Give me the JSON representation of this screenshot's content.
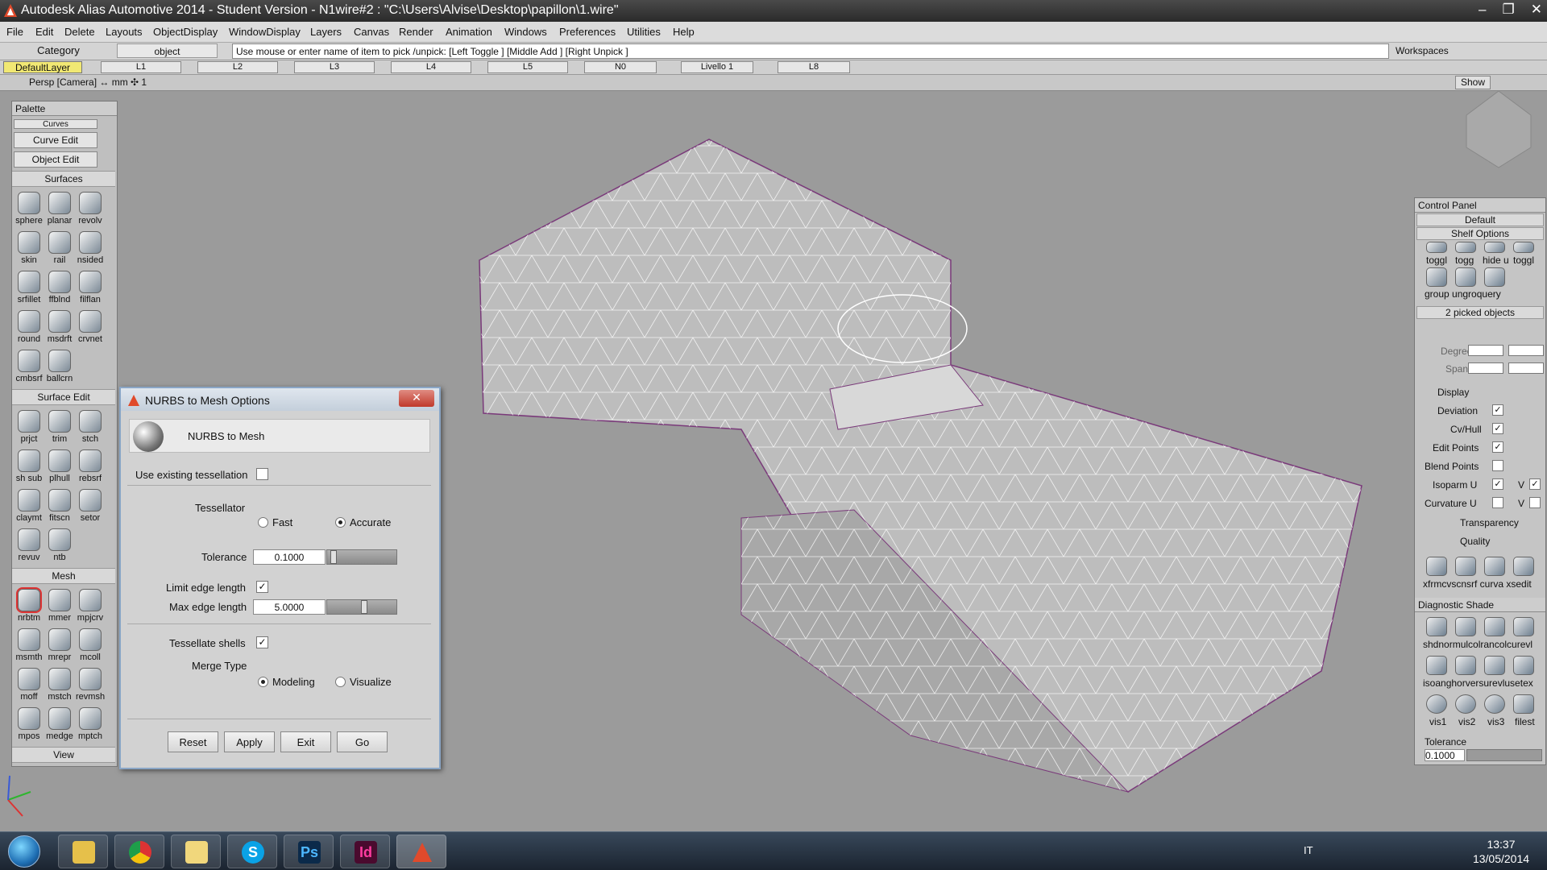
{
  "window": {
    "title": "Autodesk Alias Automotive 2014   - Student Version   - N1wire#2 : \"C:\\Users\\Alvise\\Desktop\\papillon\\1.wire\"",
    "min": "–",
    "max": "❐",
    "close": "✕"
  },
  "menu": [
    "File",
    "Edit",
    "Delete",
    "Layouts",
    "ObjectDisplay",
    "WindowDisplay",
    "Layers",
    "Canvas",
    "Render",
    "Animation",
    "Windows",
    "Preferences",
    "Utilities",
    "Help"
  ],
  "toolbar": {
    "category": "Category",
    "object": "object",
    "prompt": "Use mouse or enter name of item to pick /unpick: [Left Toggle ] [Middle Add ] [Right Unpick ]",
    "workspaces": "Workspaces"
  },
  "layers": {
    "default": "DefaultLayer",
    "items": [
      "L1",
      "L2",
      "L3",
      "L4",
      "L5",
      "N0",
      "Livello 1",
      "L8"
    ]
  },
  "viewbar": {
    "persp": "Persp [Camera] ↔ mm   ✣ 1",
    "show": "Show"
  },
  "palette": {
    "title": "Palette",
    "curves": "Curves",
    "curve_edit": "Curve Edit",
    "object_edit": "Object Edit",
    "surfaces": "Surfaces",
    "surface_tools": [
      "sphere",
      "planar",
      "revolv",
      "skin",
      "rail",
      "nsided",
      "srfillet",
      "ffblnd",
      "filflan",
      "round",
      "msdrft",
      "crvnet",
      "cmbsrf",
      "ballcrn"
    ],
    "surface_edit": "Surface Edit",
    "surface_edit_tools": [
      "prjct",
      "trim",
      "stch",
      "sh sub",
      "plhull",
      "rebsrf",
      "claymt",
      "fitscn",
      "setor",
      "revuv",
      "ntb"
    ],
    "mesh": "Mesh",
    "mesh_tools": [
      "nrbtm",
      "mmer",
      "mpjcrv",
      "msmth",
      "mrepr",
      "mcoll",
      "moff",
      "mstch",
      "revmsh",
      "mpos",
      "medge",
      "mptch"
    ],
    "view": "View"
  },
  "dialog": {
    "title": "NURBS to Mesh Options",
    "header": "NURBS to Mesh",
    "use_existing": "Use existing tessellation",
    "tessellator": "Tessellator",
    "fast": "Fast",
    "accurate": "Accurate",
    "tolerance": "Tolerance",
    "tolerance_value": "0.1000",
    "limit_edge": "Limit edge length",
    "max_edge": "Max edge length",
    "max_edge_value": "5.0000",
    "tess_shells": "Tessellate shells",
    "merge_type": "Merge Type",
    "modeling": "Modeling",
    "visualize": "Visualize",
    "check": "✓",
    "buttons": {
      "reset": "Reset",
      "apply": "Apply",
      "exit": "Exit",
      "go": "Go"
    }
  },
  "control_panel": {
    "title": "Control Panel",
    "default": "Default",
    "shelf": "Shelf Options",
    "shelf_labels": [
      "toggl",
      "togg",
      "hide u",
      "toggl"
    ],
    "group_labels": "group ungroquery",
    "picked": "2 picked objects",
    "degree": "Degree",
    "spans": "Spans",
    "display": "Display",
    "deviation": "Deviation",
    "cvhull": "Cv/Hull",
    "edit_points": "Edit Points",
    "blend_points": "Blend Points",
    "isoparm": "Isoparm U",
    "curvature": "Curvature U",
    "v": "V",
    "transparency": "Transparency",
    "quality": "Quality",
    "tools_row": "xfrmcvscnsrf curva xsedit",
    "diag": "Diagnostic Shade",
    "diag_row1": "shdnormulcolrancolcurevl",
    "diag_row2": "isoanghorversurevlusetex",
    "diag_row3": [
      "vis1",
      "vis2",
      "vis3",
      "filest"
    ],
    "tolerance": "Tolerance",
    "tolerance_value": "0.1000"
  },
  "taskbar": {
    "ps": "Ps",
    "id": "Id",
    "skype": "S",
    "lang": "IT",
    "time": "13:37",
    "date": "13/05/2014"
  }
}
